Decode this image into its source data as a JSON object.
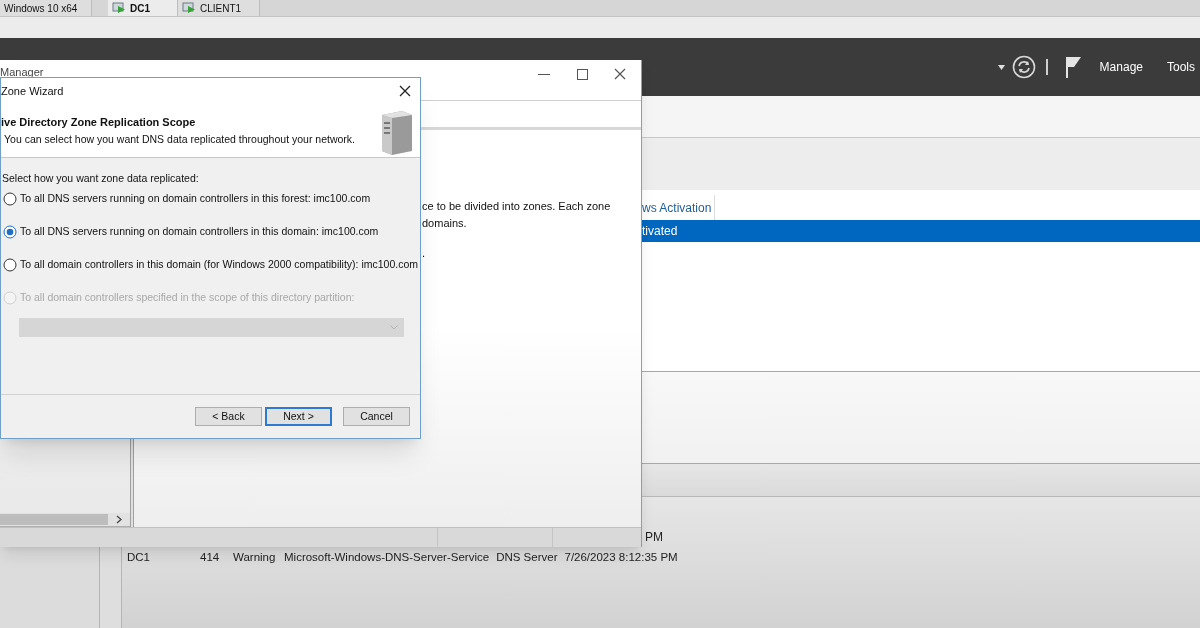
{
  "vm_tabs": [
    {
      "label": "Windows 10 x64",
      "selected": false,
      "icon": false
    },
    {
      "label": "DC1",
      "selected": true,
      "icon": true
    },
    {
      "label": "CLIENT1",
      "selected": false,
      "icon": true
    }
  ],
  "server_manager": {
    "header_menu": [
      "Manage",
      "Tools"
    ],
    "tile": {
      "column_header": "ws Activation",
      "rows": [
        {
          "text": "tivated",
          "selected": true
        }
      ]
    },
    "partial_event_text": "PM",
    "event_row": {
      "server": "DC1",
      "id": "414",
      "severity": "Warning",
      "source": "Microsoft-Windows-DNS-Server-Service",
      "log": "DNS Server",
      "date": "7/26/2023 8:12:35 PM"
    }
  },
  "dns_manager": {
    "title": "Manager",
    "body_lines": [
      "ce to be divided into zones. Each zone",
      "domains.",
      "."
    ]
  },
  "wizard": {
    "title": "Zone Wizard",
    "heading": "ive Directory Zone Replication Scope",
    "subheading": "You can select how you want DNS data replicated throughout your network.",
    "prompt": "Select how you want zone data replicated:",
    "options": [
      {
        "label": "To all DNS servers running on domain controllers in this forest: imc100.com",
        "selected": false,
        "disabled": false
      },
      {
        "label": "To all DNS servers running on domain controllers in this domain: imc100.com",
        "selected": true,
        "disabled": false
      },
      {
        "label": "To all domain controllers in this domain (for Windows 2000 compatibility): imc100.com",
        "selected": false,
        "disabled": false
      },
      {
        "label": "To all domain controllers specified in the scope of this directory partition:",
        "selected": false,
        "disabled": true
      }
    ],
    "dropdown": {
      "disabled": true
    },
    "buttons": [
      {
        "label": "< Back",
        "default": false
      },
      {
        "label": "Next >",
        "default": true
      },
      {
        "label": "Cancel",
        "default": false
      }
    ]
  }
}
